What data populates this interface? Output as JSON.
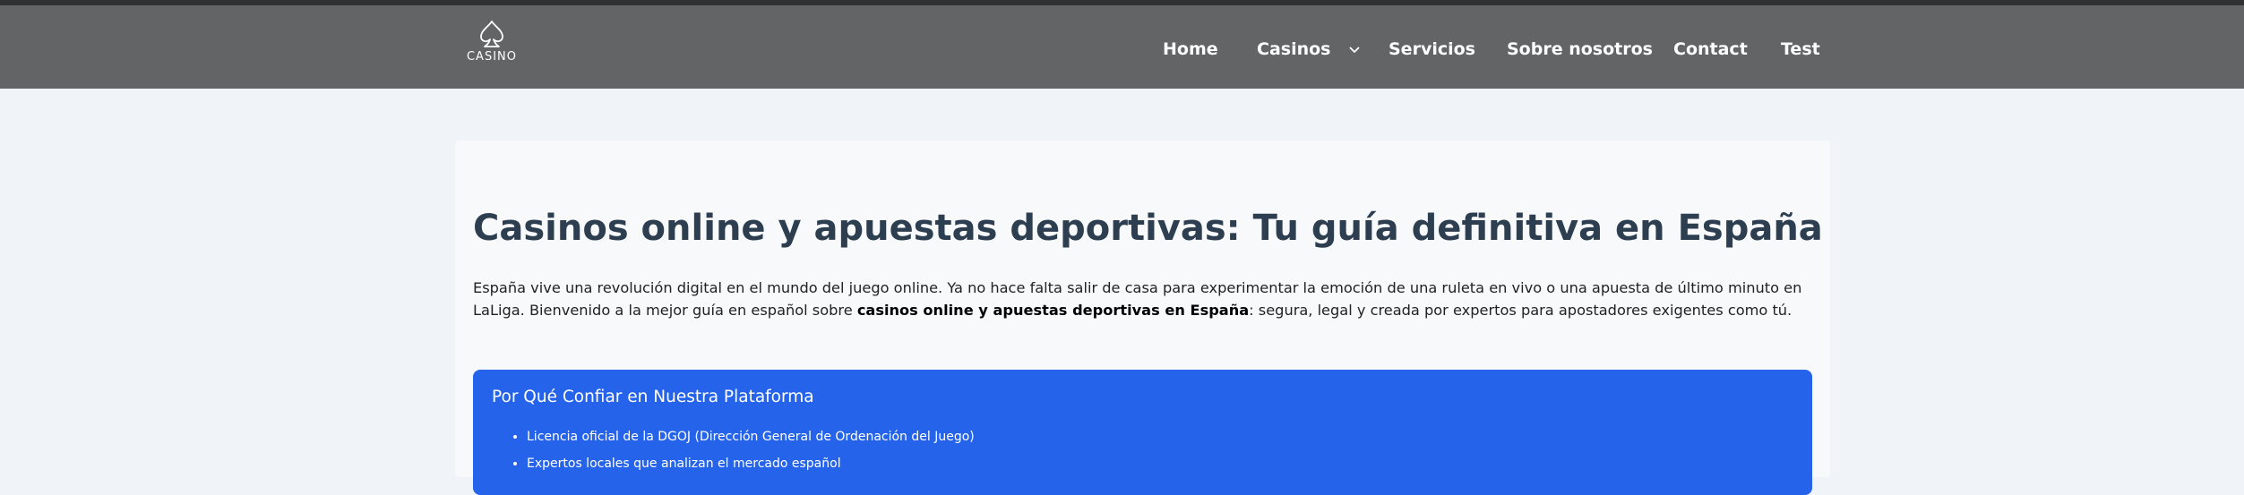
{
  "header": {
    "logo_text": "CASINO",
    "nav": [
      "Home",
      "Casinos",
      "Servicios",
      "Sobre nosotros",
      "Contact",
      "Test"
    ]
  },
  "main": {
    "title": "Casinos online y apuestas deportivas: Tu guía definitiva en España",
    "intro_part1": "España vive una revolución digital en el mundo del juego online. Ya no hace falta salir de casa para experimentar la emoción de una ruleta en vivo o una apuesta de último minuto en LaLiga. Bienvenido a la mejor guía en español sobre ",
    "intro_bold": "casinos online y apuestas deportivas en España",
    "intro_part2": ": segura, legal y creada por expertos para apostadores exigentes como tú.",
    "trust_box": {
      "title": "Por Qué Confiar en Nuestra Plataforma",
      "items": [
        "Licencia oficial de la DGOJ (Dirección General de Ordenación del Juego)",
        "Expertos locales que analizan el mercado español"
      ]
    }
  },
  "colors": {
    "navbar": "#636466",
    "page_bg": "#f0f3f8",
    "title": "#2c3e50",
    "trust_box": "#2563eb"
  },
  "icons": {
    "logo": "spade-icon",
    "casinos_dropdown": "chevron-down-icon"
  }
}
